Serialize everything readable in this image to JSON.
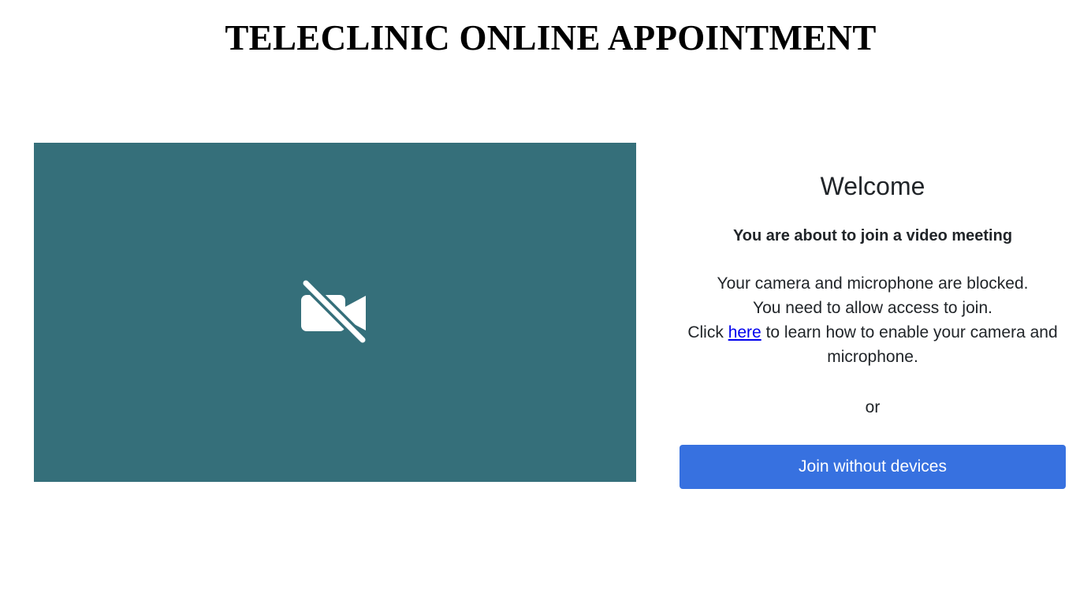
{
  "page": {
    "title": "TELECLINIC ONLINE APPOINTMENT"
  },
  "preview": {
    "background_color": "#356f7a",
    "icon": "video-camera-off-icon",
    "icon_color": "#ffffff"
  },
  "panel": {
    "welcome": "Welcome",
    "subheading": "You are about to join a video meeting",
    "blocked_line_1": "Your camera and microphone are blocked.",
    "blocked_line_2": "You need to allow access to join.",
    "click_prefix": "Click",
    "link_text": "here",
    "click_suffix": "to learn how to enable your camera and microphone.",
    "or": "or",
    "join_button_label": "Join without devices",
    "join_button_color": "#3771e0"
  }
}
